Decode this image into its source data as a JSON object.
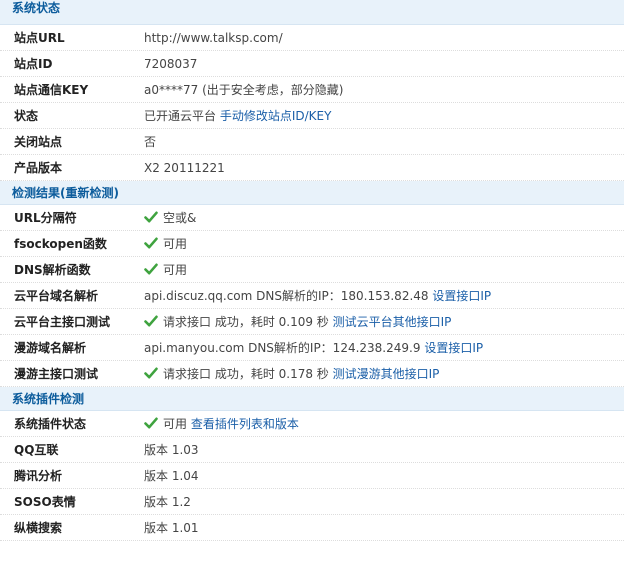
{
  "sections": {
    "status": {
      "title": "系统状态",
      "rows": [
        {
          "key": "站点URL",
          "value": "http://www.talksp.com/"
        },
        {
          "key": "站点ID",
          "value": "7208037"
        },
        {
          "key": "站点通信KEY",
          "value": "a0****77 (出于安全考虑，部分隐藏)"
        },
        {
          "key": "状态",
          "value": "已开通云平台",
          "link": "手动修改站点ID/KEY"
        },
        {
          "key": "关闭站点",
          "value": "否"
        },
        {
          "key": "产品版本",
          "value": "X2 20111221"
        }
      ]
    },
    "detect": {
      "title": "检测结果",
      "title_paren_open": "(",
      "title_link": "重新检测",
      "title_paren_close": ")",
      "rows": [
        {
          "key": "URL分隔符",
          "value": "空或&"
        },
        {
          "key": "fsockopen函数",
          "value": "可用"
        },
        {
          "key": "DNS解析函数",
          "value": "可用"
        },
        {
          "key": "云平台域名解析",
          "value": "api.discuz.qq.com DNS解析的IP：180.153.82.48",
          "link": "设置接口IP"
        },
        {
          "key": "云平台主接口测试",
          "value": "请求接口 成功，耗时 0.109 秒",
          "link": "测试云平台其他接口IP"
        },
        {
          "key": "漫游域名解析",
          "value": "api.manyou.com DNS解析的IP：124.238.249.9",
          "link": "设置接口IP"
        },
        {
          "key": "漫游主接口测试",
          "value": "请求接口 成功，耗时 0.178 秒",
          "link": "测试漫游其他接口IP"
        }
      ]
    },
    "plugins": {
      "title": "系统插件检测",
      "rows": [
        {
          "key": "系统插件状态",
          "value": "可用",
          "link": "查看插件列表和版本"
        },
        {
          "key": "QQ互联",
          "value": "版本 1.03"
        },
        {
          "key": "腾讯分析",
          "value": "版本 1.04"
        },
        {
          "key": "SOSO表情",
          "value": "版本 1.2"
        },
        {
          "key": "纵横搜索",
          "value": "版本 1.01"
        }
      ]
    }
  },
  "icons": {
    "ok": "green-check-icon",
    "ok_color": "#3fa33f"
  }
}
